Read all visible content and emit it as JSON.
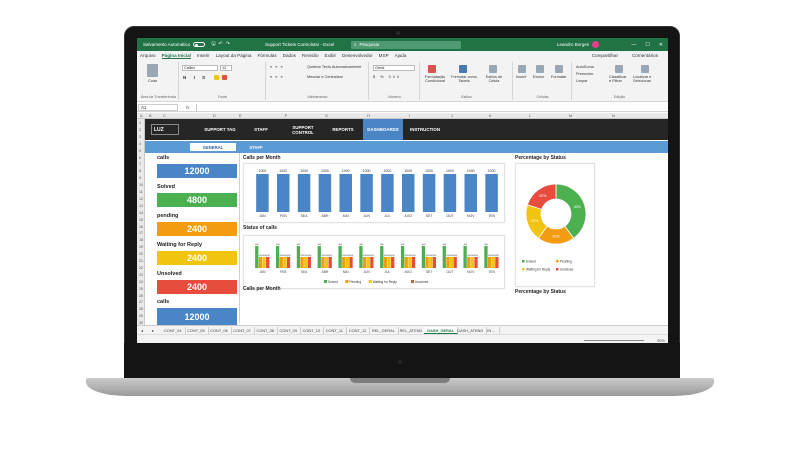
{
  "window": {
    "autosave_label": "Salvamento Automático",
    "doc_title": "Support Tickets Controlstar - Excel",
    "search_placeholder": "Pesquisar",
    "user_name": "Leandro Borges",
    "accent": "#217346"
  },
  "menu": [
    "Arquivo",
    "Página Inicial",
    "Inserir",
    "Layout da Página",
    "Fórmulas",
    "Dados",
    "Revisão",
    "Exibir",
    "Desenvolvedor",
    "MSP",
    "Ajuda"
  ],
  "menu_active": "Página Inicial",
  "menu_share": "Compartilhar",
  "menu_comments": "Comentários",
  "ribbon": {
    "paste": "Colar",
    "clipboard": "Área de Transferência",
    "font_name": "Calibri",
    "font_size": "12",
    "font_group": "Fonte",
    "wrap_text": "Quebrar Texto Automaticamente",
    "merge_center": "Mesclar e Centralizar",
    "alignment_group": "Alinhamento",
    "number_format": "Geral",
    "number_group": "Número",
    "cond_format": "Formatação Condicional",
    "format_table": "Formatar como Tabela",
    "cell_styles": "Estilos de Célula",
    "styles_group": "Estilos",
    "insert": "Inserir",
    "delete": "Excluir",
    "format": "Formatar",
    "cells_group": "Células",
    "autosum": "AutoSoma",
    "fill": "Preencher",
    "clear": "Limpar",
    "sort_filter": "Classificar e Filtrar",
    "find_select": "Localizar e Selecionar",
    "editing_group": "Edição"
  },
  "formula_bar": {
    "name_box": "A1",
    "fx": "fx"
  },
  "columns": [
    "A",
    "B",
    "C",
    "D",
    "E",
    "F",
    "G",
    "H",
    "I",
    "J",
    "K",
    "L",
    "M",
    "N"
  ],
  "rows": [
    "1",
    "2",
    "3",
    "4",
    "5",
    "6",
    "7",
    "8",
    "9",
    "10",
    "11",
    "12",
    "13",
    "14",
    "15",
    "16",
    "17",
    "18",
    "19",
    "20",
    "21",
    "22",
    "23",
    "24",
    "25",
    "26",
    "27",
    "28",
    "29",
    "30"
  ],
  "nav": {
    "logo": "LUZ",
    "items": [
      "SUPPORT TAG",
      "STAFF",
      "SUPPORT CONTROL",
      "REPORTS",
      "DASHBOARDS",
      "INSTRUCTION"
    ],
    "active": "DASHBOARDS",
    "subtabs": [
      "GENERAL",
      "STAFF"
    ]
  },
  "kpis": [
    {
      "label": "calls",
      "value": "12000",
      "color": "#4a86c5"
    },
    {
      "label": "Solved",
      "value": "4800",
      "color": "#4caf50"
    },
    {
      "label": "pending",
      "value": "2400",
      "color": "#f39c12"
    },
    {
      "label": "Waiting for Reply",
      "value": "2400",
      "color": "#f1c40f"
    },
    {
      "label": "Unsolved",
      "value": "2400",
      "color": "#e74c3c"
    },
    {
      "label": "calls",
      "value": "12000",
      "color": "#4a86c5"
    }
  ],
  "chart_data": [
    {
      "type": "bar",
      "title": "Calls per Month",
      "categories": [
        "JAN",
        "FEB",
        "SEA",
        "ABR",
        "MAI",
        "JUN",
        "JUL",
        "AGO",
        "SET",
        "OUT",
        "NOV",
        "TEN"
      ],
      "values": [
        1000,
        1000,
        1000,
        1000,
        1000,
        1000,
        1000,
        1000,
        1000,
        1000,
        1000,
        1000
      ],
      "ylim": [
        0,
        1000
      ],
      "color": "#4a86c5"
    },
    {
      "type": "bar",
      "title": "Status of calls",
      "categories": [
        "JAN",
        "FEB",
        "SEA",
        "ABR",
        "MAI",
        "JUN",
        "JUL",
        "AGO",
        "SET",
        "OUT",
        "NOV",
        "TEN"
      ],
      "series": [
        {
          "name": "Solved",
          "values": [
            400,
            400,
            400,
            400,
            400,
            400,
            400,
            400,
            400,
            400,
            400,
            400
          ],
          "color": "#4caf50"
        },
        {
          "name": "Pending",
          "values": [
            200,
            200,
            200,
            200,
            200,
            200,
            200,
            200,
            200,
            200,
            200,
            200
          ],
          "color": "#f39c12"
        },
        {
          "name": "Waiting for Reply",
          "values": [
            200,
            200,
            200,
            200,
            200,
            200,
            200,
            200,
            200,
            200,
            200,
            200
          ],
          "color": "#f1c40f"
        },
        {
          "name": "Unsolved",
          "values": [
            200,
            200,
            200,
            200,
            200,
            200,
            200,
            200,
            200,
            200,
            200,
            200
          ],
          "color": "#e74c3c"
        }
      ],
      "ylim": [
        0,
        400
      ],
      "legend": "bottom"
    },
    {
      "type": "pie",
      "title": "Percentage by Status",
      "categories": [
        "Solved",
        "Pending",
        "Waiting for Reply",
        "Unsolved"
      ],
      "values": [
        40,
        20,
        20,
        20
      ],
      "labels": [
        "40%",
        "20%",
        "20%",
        "20%"
      ],
      "colors": [
        "#4caf50",
        "#f39c12",
        "#f1c40f",
        "#e74c3c"
      ],
      "legend": "bottom",
      "donut": true
    }
  ],
  "lower_titles": {
    "calls_month": "Calls per Month",
    "pct_status": "Percentage by Status"
  },
  "sheets": [
    "CONT_04",
    "CONT_05",
    "CONT_06",
    "CONT_07",
    "CONT_08",
    "CONT_09",
    "CONT_10",
    "CONT_11",
    "CONT_12",
    "REL_GERAL",
    "REL_ATEND",
    "DASH_GERAL",
    "DASH_ATEND",
    "IN ..."
  ],
  "active_sheet": "DASH_GERAL",
  "zoom": "90%"
}
